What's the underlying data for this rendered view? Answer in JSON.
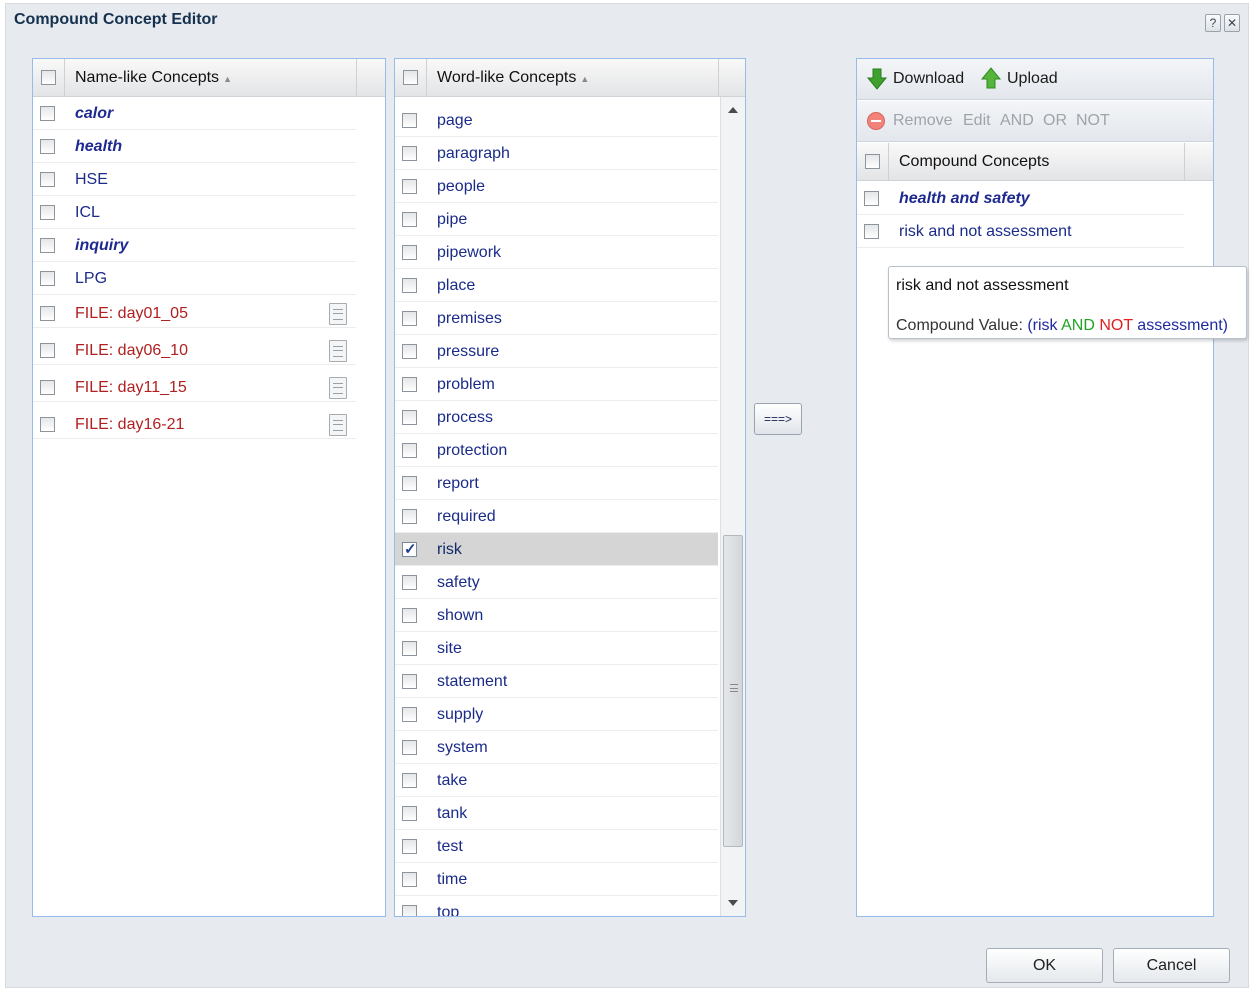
{
  "window": {
    "title": "Compound Concept Editor",
    "help_glyph": "?",
    "close_glyph": "✕"
  },
  "name_panel": {
    "header": "Name-like Concepts",
    "sort_glyph": "▲",
    "items": [
      {
        "label": "calor",
        "style": "bold-italic",
        "has_doc": false
      },
      {
        "label": "health",
        "style": "bold-italic",
        "has_doc": false
      },
      {
        "label": "HSE",
        "style": "normal",
        "has_doc": false
      },
      {
        "label": "ICL",
        "style": "normal",
        "has_doc": false
      },
      {
        "label": "inquiry",
        "style": "bold-italic",
        "has_doc": false
      },
      {
        "label": "LPG",
        "style": "normal",
        "has_doc": false
      },
      {
        "label": "FILE: day01_05",
        "style": "file",
        "has_doc": true
      },
      {
        "label": "FILE: day06_10",
        "style": "file",
        "has_doc": true
      },
      {
        "label": "FILE: day11_15",
        "style": "file",
        "has_doc": true
      },
      {
        "label": "FILE: day16-21",
        "style": "file",
        "has_doc": true
      }
    ]
  },
  "word_panel": {
    "header": "Word-like Concepts",
    "sort_glyph": "▲",
    "items": [
      {
        "label": "page",
        "checked": false
      },
      {
        "label": "paragraph",
        "checked": false
      },
      {
        "label": "people",
        "checked": false
      },
      {
        "label": "pipe",
        "checked": false
      },
      {
        "label": "pipework",
        "checked": false
      },
      {
        "label": "place",
        "checked": false
      },
      {
        "label": "premises",
        "checked": false
      },
      {
        "label": "pressure",
        "checked": false
      },
      {
        "label": "problem",
        "checked": false
      },
      {
        "label": "process",
        "checked": false
      },
      {
        "label": "protection",
        "checked": false
      },
      {
        "label": "report",
        "checked": false
      },
      {
        "label": "required",
        "checked": false
      },
      {
        "label": "risk",
        "checked": true
      },
      {
        "label": "safety",
        "checked": false
      },
      {
        "label": "shown",
        "checked": false
      },
      {
        "label": "site",
        "checked": false
      },
      {
        "label": "statement",
        "checked": false
      },
      {
        "label": "supply",
        "checked": false
      },
      {
        "label": "system",
        "checked": false
      },
      {
        "label": "take",
        "checked": false
      },
      {
        "label": "tank",
        "checked": false
      },
      {
        "label": "test",
        "checked": false
      },
      {
        "label": "time",
        "checked": false
      },
      {
        "label": "top",
        "checked": false
      }
    ],
    "scroll_position": 0.58
  },
  "move_button": "===>",
  "compound_panel": {
    "toolbar": {
      "download": "Download",
      "upload": "Upload",
      "remove": "Remove",
      "edit": "Edit",
      "and": "AND",
      "or": "OR",
      "not": "NOT"
    },
    "header": "Compound Concepts",
    "items": [
      {
        "label": "health and safety",
        "style": "bold-italic"
      },
      {
        "label": "risk and not assessment",
        "style": "normal"
      }
    ]
  },
  "tooltip": {
    "title": "risk and not assessment",
    "value_prefix": "Compound Value: ",
    "open_paren": "(",
    "term1": "risk",
    "op1": "AND",
    "op2": "NOT",
    "term2": "assessment",
    "close_paren": ")"
  },
  "footer": {
    "ok": "OK",
    "cancel": "Cancel"
  },
  "colors": {
    "download_arrow": "#3fa12d",
    "upload_arrow": "#55b43a",
    "remove_icon": "#f2837b",
    "name_concept": "#1f2a90",
    "file_concept": "#b02020"
  }
}
